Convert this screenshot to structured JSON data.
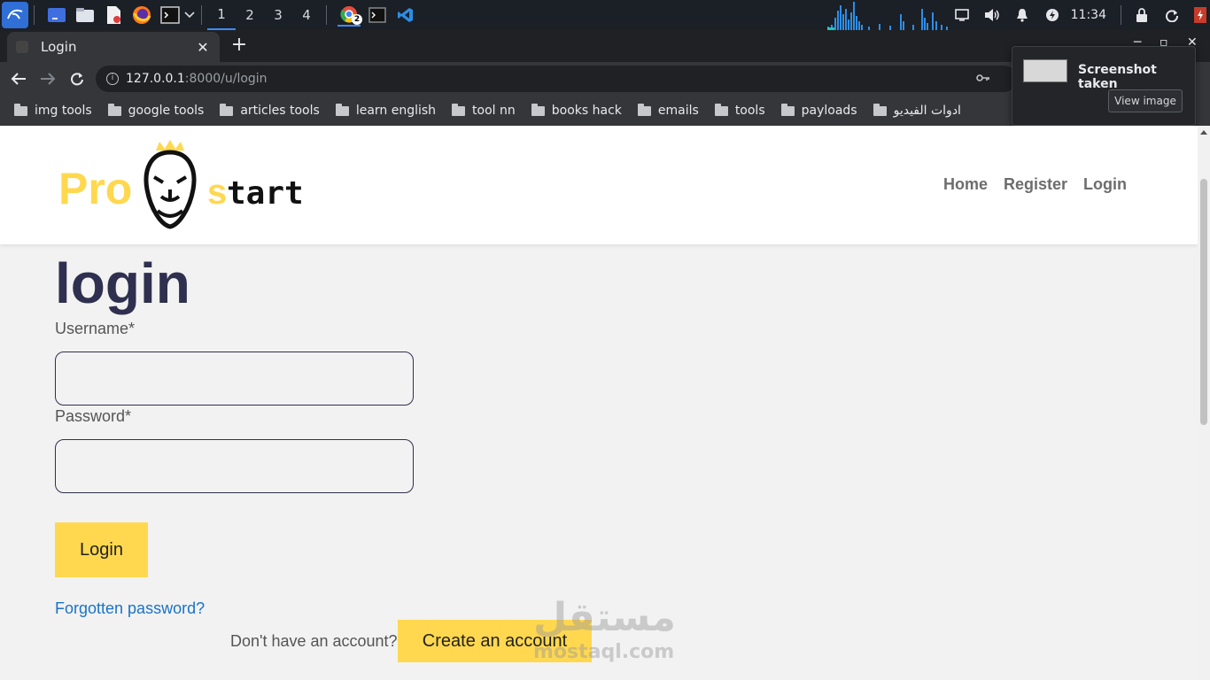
{
  "taskbar": {
    "workspaces": [
      "1",
      "2",
      "3",
      "4"
    ],
    "active_workspace": 0,
    "chrome_badge": "2",
    "clock": "11:34",
    "icons": [
      "kali-menu-icon",
      "desktop-icon",
      "file-manager-icon",
      "text-editor-icon",
      "firefox-icon",
      "terminal-icon",
      "chrome-icon",
      "terminal-window-icon",
      "vscode-icon",
      "display-icon",
      "volume-icon",
      "bell-icon",
      "power-icon",
      "lock-icon",
      "restart-icon",
      "logout-icon"
    ]
  },
  "browser": {
    "tab_title": "Login",
    "tab_close": "✕",
    "new_tab": "+",
    "url_host": "127.0.0.1",
    "url_path": ":8000/u/login",
    "bookmarks": [
      "img tools",
      "google tools",
      "articles tools",
      "learn english",
      "tool nn",
      "books hack",
      "emails",
      "tools",
      "payloads",
      "ادوات الفيديو"
    ]
  },
  "notification": {
    "title": "Screenshot taken",
    "button": "View image"
  },
  "site": {
    "logo": {
      "part1": "Pro",
      "part2": "start"
    },
    "nav": [
      "Home",
      "Register",
      "Login"
    ],
    "heading": "login",
    "username_label": "Username*",
    "password_label": "Password*",
    "username_value": "",
    "password_value": "",
    "login_button": "Login",
    "forgot_link": "Forgotten password?",
    "no_account_text": "Don't have an account?",
    "create_button": "Create an account"
  },
  "watermark": {
    "arabic": "مستقل",
    "latin": "mostaql.com"
  },
  "colors": {
    "accent_yellow": "#ffd84f",
    "heading": "#2f2f4f",
    "link": "#1a73c7",
    "chrome_dark": "#202124",
    "chrome_toolbar": "#35363a"
  }
}
